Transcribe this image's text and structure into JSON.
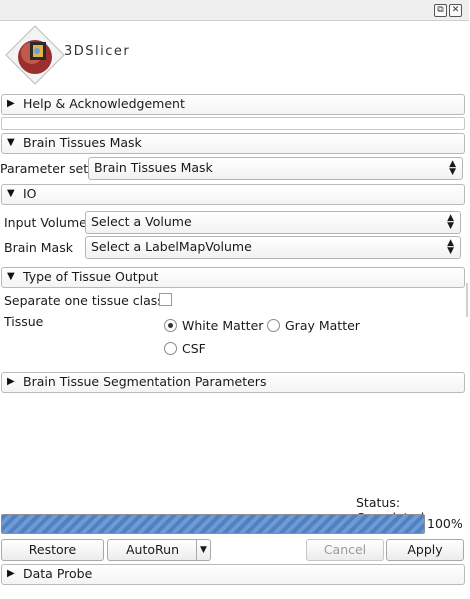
{
  "window": {
    "restore_icon": "restore-icon",
    "close_icon": "close-icon"
  },
  "brand": {
    "name": "3DSlicer"
  },
  "help_panel": {
    "label": "Help & Acknowledgement",
    "collapsed": true
  },
  "module_panel": {
    "label": "Brain Tissues Mask",
    "parameter_set": {
      "label": "Parameter set:",
      "value": "Brain Tissues Mask"
    }
  },
  "io_panel": {
    "label": "IO",
    "input_volume": {
      "label": "Input Volume",
      "value": "Select a Volume"
    },
    "brain_mask": {
      "label": "Brain Mask",
      "value": "Select a LabelMapVolume"
    }
  },
  "tissue_panel": {
    "label": "Type of Tissue Output",
    "separate": {
      "label": "Separate one tissue class",
      "checked": false
    },
    "tissue": {
      "label": "Tissue",
      "options": [
        {
          "label": "White Matter",
          "selected": true
        },
        {
          "label": "Gray Matter",
          "selected": false
        },
        {
          "label": "CSF",
          "selected": false
        }
      ]
    }
  },
  "segmentation_panel": {
    "label": "Brain Tissue Segmentation Parameters",
    "collapsed": true
  },
  "status": {
    "text": "Status: Completed"
  },
  "progress": {
    "value": 1.0,
    "label": "100%"
  },
  "buttons": {
    "restore_defaults": "Restore Defaults",
    "autorun": "AutoRun",
    "cancel": "Cancel",
    "apply": "Apply"
  },
  "data_probe": {
    "label": "Data Probe",
    "collapsed": true
  },
  "colors": {
    "progress_fill": "#4e82c3",
    "progress_stripe": "#6f9ad2"
  }
}
